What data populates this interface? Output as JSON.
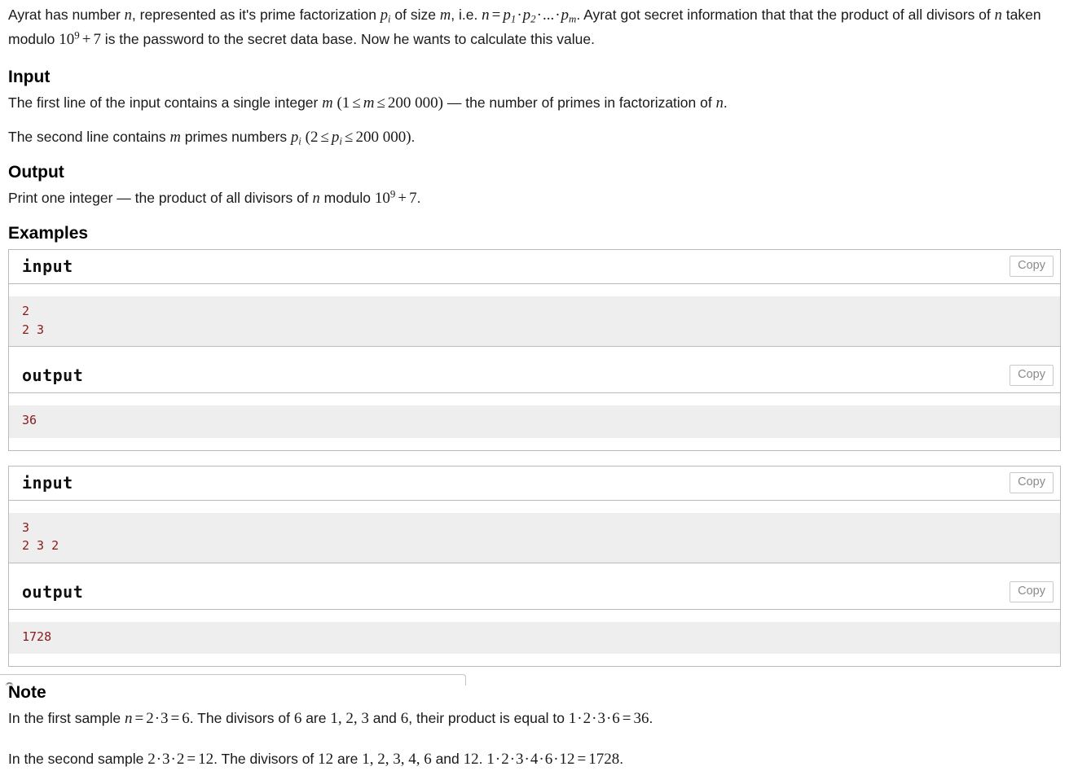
{
  "problem": {
    "statement": {
      "part1": "Ayrat has number ",
      "var_n": "n",
      "part2": ", represented as it's prime factorization ",
      "var_p": "p",
      "sub_i": "i",
      "part3": " of size ",
      "var_m": "m",
      "part4": ", i.e. ",
      "formula_n": "n = p1·p2·...·pm",
      "part5": ". Ayrat got secret information that that the product of all divisors of ",
      "part6": " taken modulo ",
      "formula_mod": "10^9 + 7",
      "part7": " is the password to the secret data base. Now he wants to calculate this value."
    },
    "input": {
      "heading": "Input",
      "line1_a": "The first line of the input contains a single integer ",
      "line1_var": "m",
      "line1_constraint": "(1 ≤ m ≤ 200 000)",
      "line1_b": " — the number of primes in factorization of ",
      "line1_var2": "n",
      "line1_c": ".",
      "line2_a": "The second line contains ",
      "line2_var": "m",
      "line2_b": " primes numbers ",
      "line2_var2": "p",
      "line2_sub": "i",
      "line2_constraint": "(2 ≤ pi ≤ 200 000)",
      "line2_c": "."
    },
    "output": {
      "heading": "Output",
      "line_a": "Print one integer — the product of all divisors of ",
      "line_var": "n",
      "line_b": " modulo ",
      "line_formula": "10^9 + 7",
      "line_c": "."
    },
    "examples": {
      "heading": "Examples",
      "copy_label": "Copy",
      "input_label": "input",
      "output_label": "output",
      "tests": [
        {
          "input": "2\n2 3",
          "output": "36"
        },
        {
          "input": "3\n2 3 2",
          "output": "1728"
        }
      ]
    },
    "note": {
      "heading": "Note",
      "p1_a": "In the first sample ",
      "p1_var": "n",
      "p1_eq": "= 2·3 = 6",
      "p1_b": ". The divisors of ",
      "p1_six": "6",
      "p1_c": " are ",
      "p1_list": "1, 2, 3",
      "p1_d": " and ",
      "p1_six2": "6",
      "p1_e": ", their product is equal to ",
      "p1_prod": "1·2·3·6 = 36",
      "p1_f": ".",
      "p2_a": "In the second sample ",
      "p2_eq": "2·3·2 = 12",
      "p2_b": ". The divisors of ",
      "p2_twelve": "12",
      "p2_c": " are ",
      "p2_list": "1, 2, 3, 4, 6",
      "p2_d": " and ",
      "p2_twelve2": "12",
      "p2_e": ". ",
      "p2_prod": "1·2·3·4·6·12 = 1728",
      "p2_f": "."
    }
  },
  "status_bar": {
    "text": ""
  },
  "colors": {
    "code_text": "#8b1a1a",
    "code_bg": "#eeeeee",
    "border": "#bbbbbb",
    "copy_text": "#8a8a8a"
  }
}
